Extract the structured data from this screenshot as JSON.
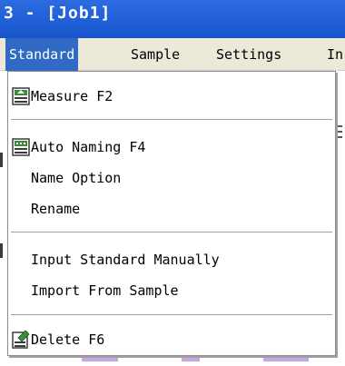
{
  "window": {
    "title": "3 - [Job1]"
  },
  "menubar": {
    "items": [
      {
        "label": "Standard",
        "active": true
      },
      {
        "label": "Sample"
      },
      {
        "label": "Settings"
      },
      {
        "label": "In"
      }
    ]
  },
  "dropdown": {
    "items": [
      {
        "label": "Measure F2",
        "icon": "measure-icon"
      },
      {
        "label": "Auto Naming F4",
        "icon": "auto-naming-icon"
      },
      {
        "label": "Name Option"
      },
      {
        "label": "Rename"
      },
      {
        "label": "Input Standard Manually"
      },
      {
        "label": "Import From Sample"
      },
      {
        "label": "Delete F6",
        "icon": "delete-icon"
      }
    ]
  },
  "colors": {
    "titlebar": "#1f5fd8",
    "menu_highlight": "#316ac5",
    "menubar_bg": "#ece9d8",
    "icon_green": "#3c8c3c"
  }
}
